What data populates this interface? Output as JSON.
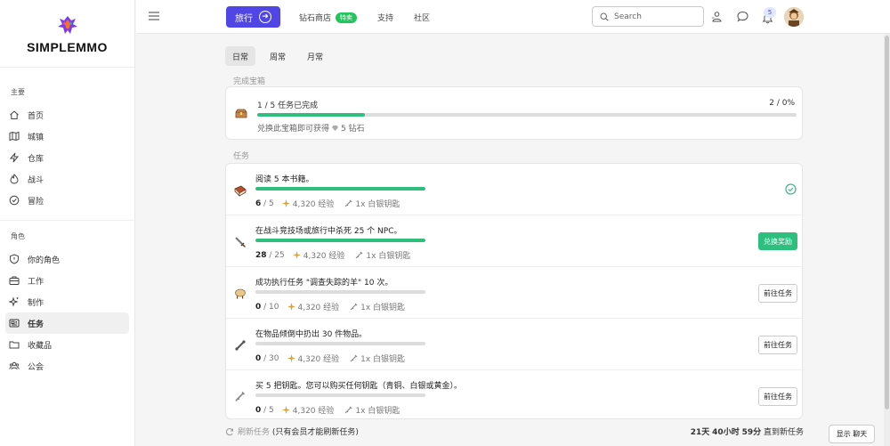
{
  "brand": {
    "name": "SIMPLEMMO"
  },
  "sidebar": {
    "section_main": "主要",
    "main_items": [
      {
        "label": "首页",
        "icon": "home-icon"
      },
      {
        "label": "城镇",
        "icon": "map-icon"
      },
      {
        "label": "仓库",
        "icon": "lightning-icon"
      },
      {
        "label": "战斗",
        "icon": "fire-icon"
      },
      {
        "label": "冒险",
        "icon": "check-circle-icon"
      }
    ],
    "section_character": "角色",
    "character_items": [
      {
        "label": "你的角色",
        "icon": "shield-icon"
      },
      {
        "label": "工作",
        "icon": "briefcase-icon"
      },
      {
        "label": "制作",
        "icon": "sparkles-icon"
      },
      {
        "label": "任务",
        "icon": "newspaper-icon",
        "active": true
      },
      {
        "label": "收藏品",
        "icon": "folder-icon"
      },
      {
        "label": "公会",
        "icon": "users-icon"
      }
    ]
  },
  "topbar": {
    "travel_label": "旅行",
    "shop_label": "钻石商店",
    "shop_badge": "特卖",
    "support_label": "支持",
    "community_label": "社区",
    "search_placeholder": "Search",
    "notification_count": "5"
  },
  "tabs": [
    "日常",
    "周常",
    "月常"
  ],
  "chest": {
    "section_title": "完成宝箱",
    "progress_text": "1 / 5 任务已完成",
    "progress_fraction": 0.2,
    "percent_text": "2 / 0%",
    "reward_prefix": "兑换此宝箱即可获得",
    "reward_amount": "5 钻石"
  },
  "tasks_section_title": "任务",
  "tasks": [
    {
      "title": "阅读 5 本书籍。",
      "current": "6",
      "total": "/ 5",
      "progress": 1.0,
      "xp": "4,320 经验",
      "reward": "1x 白银钥匙",
      "status": "done",
      "icon": "book-icon"
    },
    {
      "title": "在战斗竞技场或旅行中杀死 25 个 NPC。",
      "current": "28",
      "total": "/ 25",
      "progress": 1.0,
      "xp": "4,320 经验",
      "reward": "1x 白银钥匙",
      "status": "claim",
      "action_label": "兑换奖励",
      "icon": "sword-icon"
    },
    {
      "title": "成功执行任务 \"调查失踪的羊\" 10 次。",
      "current": "0",
      "total": "/ 10",
      "progress": 0,
      "xp": "4,320 经验",
      "reward": "1x 白银钥匙",
      "status": "go",
      "action_label": "前往任务",
      "icon": "sheep-icon"
    },
    {
      "title": "在物品倾倒中扔出 30 件物品。",
      "current": "0",
      "total": "/ 30",
      "progress": 0,
      "xp": "4,320 经验",
      "reward": "1x 白银钥匙",
      "status": "go",
      "action_label": "前往任务",
      "icon": "bone-icon"
    },
    {
      "title": "买 5 把钥匙。您可以购买任何钥匙（青铜、白银或黄金）。",
      "current": "0",
      "total": "/ 5",
      "progress": 0,
      "xp": "4,320 经验",
      "reward": "1x 白银钥匙",
      "status": "go",
      "action_label": "前往任务",
      "icon": "key-icon"
    }
  ],
  "footer": {
    "refresh_label": "刷新任务",
    "refresh_note": "(只有会员才能刷新任务)",
    "countdown_days": "21天",
    "countdown_hours": "40小时",
    "countdown_minutes": "59分",
    "countdown_suffix": "直到新任务"
  },
  "chat_button": "显示 聊天",
  "colors": {
    "primary": "#4f46e5",
    "success": "#2ebf7f"
  }
}
